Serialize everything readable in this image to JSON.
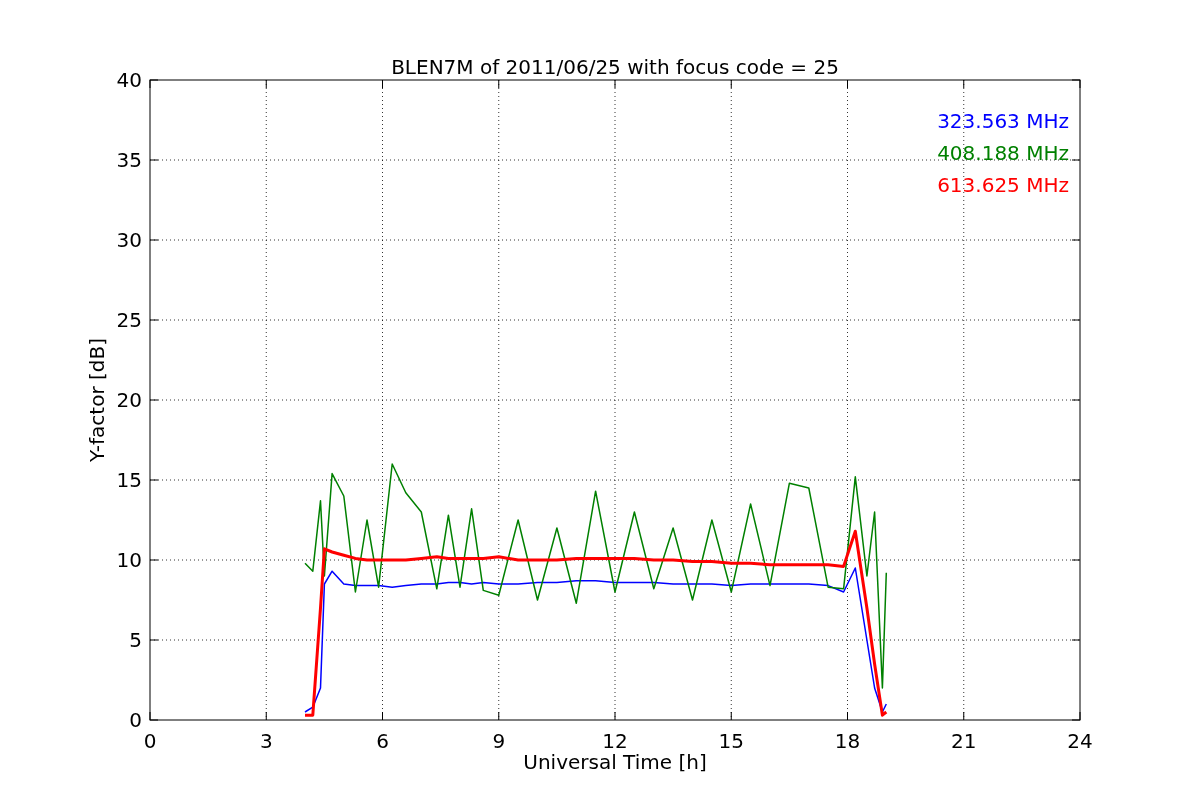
{
  "chart_data": {
    "type": "line",
    "title": "BLEN7M of 2011/06/25 with focus code = 25",
    "xlabel": "Universal Time [h]",
    "ylabel": "Y-factor [dB]",
    "x": [
      4,
      4.2,
      4.4,
      4.5,
      4.7,
      5,
      5.3,
      5.6,
      5.9,
      6.25,
      6.6,
      7,
      7.4,
      7.7,
      8,
      8.3,
      8.6,
      9,
      9.5,
      10,
      10.5,
      11,
      11.5,
      12,
      12.5,
      13,
      13.5,
      14,
      14.5,
      15,
      15.5,
      16,
      16.5,
      17,
      17.5,
      17.9,
      18.2,
      18.5,
      18.7,
      18.9,
      19
    ],
    "series": [
      {
        "name": "323.563 MHz",
        "color": "#0000ff",
        "values": [
          0.5,
          0.8,
          2,
          8.5,
          9.3,
          8.5,
          8.4,
          8.4,
          8.4,
          8.3,
          8.4,
          8.5,
          8.5,
          8.6,
          8.6,
          8.5,
          8.6,
          8.5,
          8.5,
          8.6,
          8.6,
          8.7,
          8.7,
          8.6,
          8.6,
          8.6,
          8.5,
          8.5,
          8.5,
          8.4,
          8.5,
          8.5,
          8.5,
          8.5,
          8.4,
          8.0,
          9.5,
          5,
          2,
          0.5,
          1
        ]
      },
      {
        "name": "408.188 MHz",
        "color": "#008000",
        "values": [
          9.8,
          9.3,
          13.7,
          9,
          15.4,
          14,
          8,
          12.5,
          8.3,
          16,
          14.2,
          13,
          8.2,
          12.8,
          8.3,
          13.2,
          8.1,
          7.8,
          12.5,
          7.5,
          12,
          7.3,
          14.3,
          8,
          13,
          8.2,
          12,
          7.5,
          12.5,
          8,
          13.5,
          8.4,
          14.8,
          14.5,
          8.3,
          8.2,
          15.2,
          9,
          13,
          2,
          9.2
        ]
      },
      {
        "name": "613.625 MHz",
        "color": "#ff0000",
        "values": [
          0.3,
          0.3,
          7,
          10.7,
          10.5,
          10.3,
          10.1,
          10.0,
          10.0,
          10.0,
          10.0,
          10.1,
          10.2,
          10.1,
          10.1,
          10.1,
          10.1,
          10.2,
          10.0,
          10.0,
          10.0,
          10.1,
          10.1,
          10.1,
          10.1,
          10.0,
          10.0,
          9.9,
          9.9,
          9.8,
          9.8,
          9.7,
          9.7,
          9.7,
          9.7,
          9.6,
          11.8,
          7,
          3.5,
          0.3,
          0.5
        ]
      }
    ],
    "grid": true,
    "xlim": [
      0,
      24
    ],
    "ylim": [
      0,
      40
    ],
    "xticks": [
      0,
      3,
      6,
      9,
      12,
      15,
      18,
      21,
      24
    ],
    "yticks": [
      0,
      5,
      10,
      15,
      20,
      25,
      30,
      35,
      40
    ]
  }
}
